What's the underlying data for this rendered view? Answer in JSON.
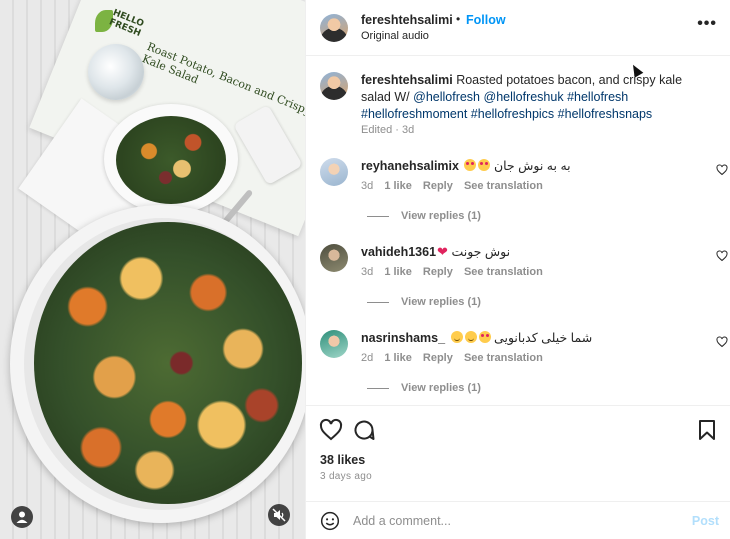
{
  "media": {
    "brand_text": "HELLO FRESH",
    "recipe_card_title": "Roast Potato, Bacon and Crispy Kale Salad"
  },
  "header": {
    "username": "fereshtehsalimi",
    "separator": "•",
    "follow_label": "Follow",
    "audio_label": "Original audio",
    "more_label": "•••"
  },
  "caption": {
    "username": "fereshtehsalimi",
    "text": "Roasted potatoes bacon, and crispy kale salad W/",
    "tags": [
      "@hellofresh",
      "@hellofreshuk",
      "#hellofresh",
      "#hellofreshmoment",
      "#hellofreshpics",
      "#hellofreshsnaps"
    ],
    "meta": "Edited · 3d"
  },
  "comments": [
    {
      "username": "reyhanehsalimix",
      "text": "به به نوش جان",
      "age": "3d",
      "likes": "1 like",
      "reply_label": "Reply",
      "translate_label": "See translation",
      "replies_label": "View replies (1)"
    },
    {
      "username": "vahideh1361",
      "text": "نوش جونت",
      "age": "3d",
      "likes": "1 like",
      "reply_label": "Reply",
      "translate_label": "See translation",
      "replies_label": "View replies (1)"
    },
    {
      "username": "nasrinshams_",
      "text": "شما خیلی کدبانویی",
      "age": "2d",
      "likes": "1 like",
      "reply_label": "Reply",
      "translate_label": "See translation",
      "replies_label": "View replies (1)"
    }
  ],
  "actions": {
    "likes_count": "38 likes",
    "time_ago": "3 days ago"
  },
  "add_comment": {
    "placeholder": "Add a comment...",
    "post_label": "Post"
  },
  "colors": {
    "accent": "#0095f6",
    "post_disabled": "#b2dffc",
    "hashtag": "#00376b",
    "secondary_text": "#8e8e8e"
  }
}
